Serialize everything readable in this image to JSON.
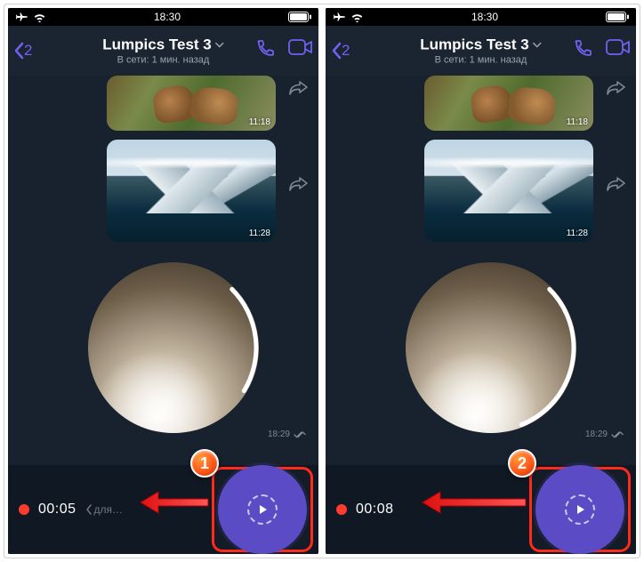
{
  "status": {
    "time": "18:30"
  },
  "header": {
    "back_count": "2",
    "title": "Lumpics Test 3",
    "subtitle": "В сети: 1 мин. назад"
  },
  "messages": {
    "img1_time": "11:18",
    "img2_time": "11:28",
    "video_time": "18:29"
  },
  "footer": {
    "left_timer": "00:05",
    "right_timer": "00:08",
    "hint": "для…"
  },
  "badges": {
    "left": "1",
    "right": "2"
  }
}
